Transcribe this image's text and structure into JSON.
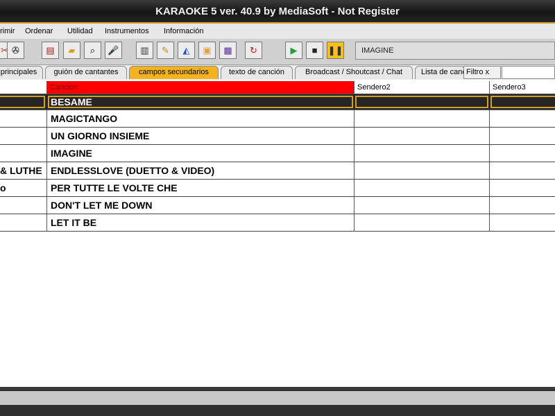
{
  "window": {
    "title": "KARAOKE 5   ver. 40.9 by MediaSoft - Not Register"
  },
  "menu": [
    "rimir",
    "Ordenar",
    "Utilidad",
    "Instrumentos",
    "Información"
  ],
  "toolbar": {
    "now_playing": "IMAGINE",
    "buttons": [
      {
        "icon": "cut-edit-icon"
      },
      {
        "icon": "film-reel-icon"
      },
      {
        "icon": "print-icon"
      },
      {
        "icon": "folder-open-icon"
      },
      {
        "icon": "search-window-icon"
      },
      {
        "icon": "microphone-icon"
      },
      {
        "icon": "keyboard-midi-icon"
      },
      {
        "icon": "edit-lyrics-icon"
      },
      {
        "icon": "paint-bucket-icon"
      },
      {
        "icon": "color-screen-icon"
      },
      {
        "icon": "video-screen-icon"
      },
      {
        "icon": "refresh-icon"
      },
      {
        "icon": "play-icon"
      },
      {
        "icon": "stop-icon"
      },
      {
        "icon": "pause-icon"
      }
    ]
  },
  "tabs": [
    {
      "label": "principales",
      "active": false
    },
    {
      "label": "guión de cantantes",
      "active": false
    },
    {
      "label": "campos secundarios",
      "active": true
    },
    {
      "label": "texto de canción",
      "active": false
    },
    {
      "label": "Broadcast / Shoutcast / Chat",
      "active": false
    },
    {
      "label": "Lista de canciones",
      "active": false
    }
  ],
  "filter": {
    "label": "Filtro x",
    "value": ""
  },
  "table": {
    "columns": [
      "",
      "Cancion",
      "Sendero2",
      "Sendero3"
    ],
    "selected_row": {
      "artist": "",
      "song": "BESAME",
      "sendero2": "",
      "sendero3": ""
    },
    "rows": [
      {
        "artist": "",
        "song": "MAGICTANGO",
        "sendero2": "",
        "sendero3": ""
      },
      {
        "artist": "",
        "song": "UN GIORNO INSIEME",
        "sendero2": "",
        "sendero3": ""
      },
      {
        "artist": "",
        "song": "IMAGINE",
        "sendero2": "",
        "sendero3": ""
      },
      {
        "artist": "& LUTHE",
        "song": "ENDLESSLOVE (DUETTO & VIDEO)",
        "sendero2": "",
        "sendero3": ""
      },
      {
        "artist": "o",
        "song": "PER TUTTE LE VOLTE CHE",
        "sendero2": "",
        "sendero3": ""
      },
      {
        "artist": "",
        "song": "DON'T LET ME DOWN",
        "sendero2": "",
        "sendero3": ""
      },
      {
        "artist": "",
        "song": "LET IT BE",
        "sendero2": "",
        "sendero3": ""
      }
    ]
  },
  "colors": {
    "accent": "#f4b21d",
    "header_highlight": "#ff0000",
    "selection": "#262626"
  }
}
